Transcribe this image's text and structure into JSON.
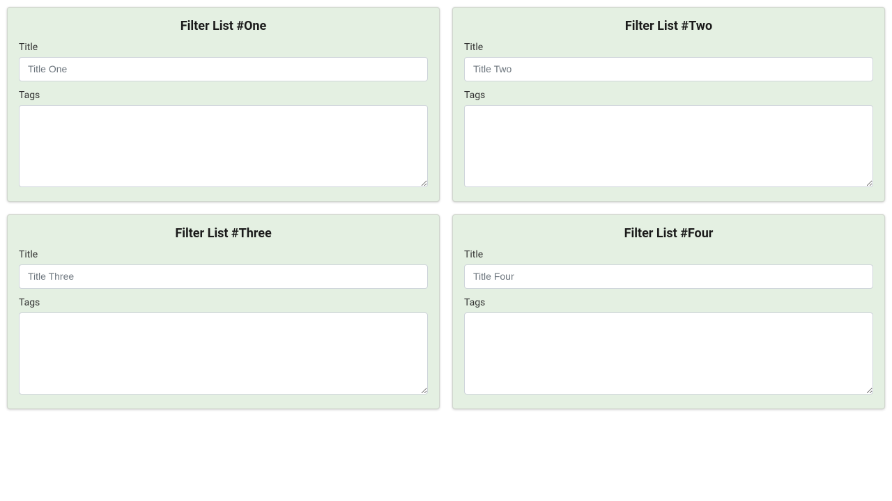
{
  "cards": [
    {
      "header": "Filter List #One",
      "title_label": "Title",
      "title_placeholder": "Title One",
      "tags_label": "Tags",
      "tags_value": ""
    },
    {
      "header": "Filter List #Two",
      "title_label": "Title",
      "title_placeholder": "Title Two",
      "tags_label": "Tags",
      "tags_value": ""
    },
    {
      "header": "Filter List #Three",
      "title_label": "Title",
      "title_placeholder": "Title Three",
      "tags_label": "Tags",
      "tags_value": ""
    },
    {
      "header": "Filter List #Four",
      "title_label": "Title",
      "title_placeholder": "Title Four",
      "tags_label": "Tags",
      "tags_value": ""
    }
  ]
}
